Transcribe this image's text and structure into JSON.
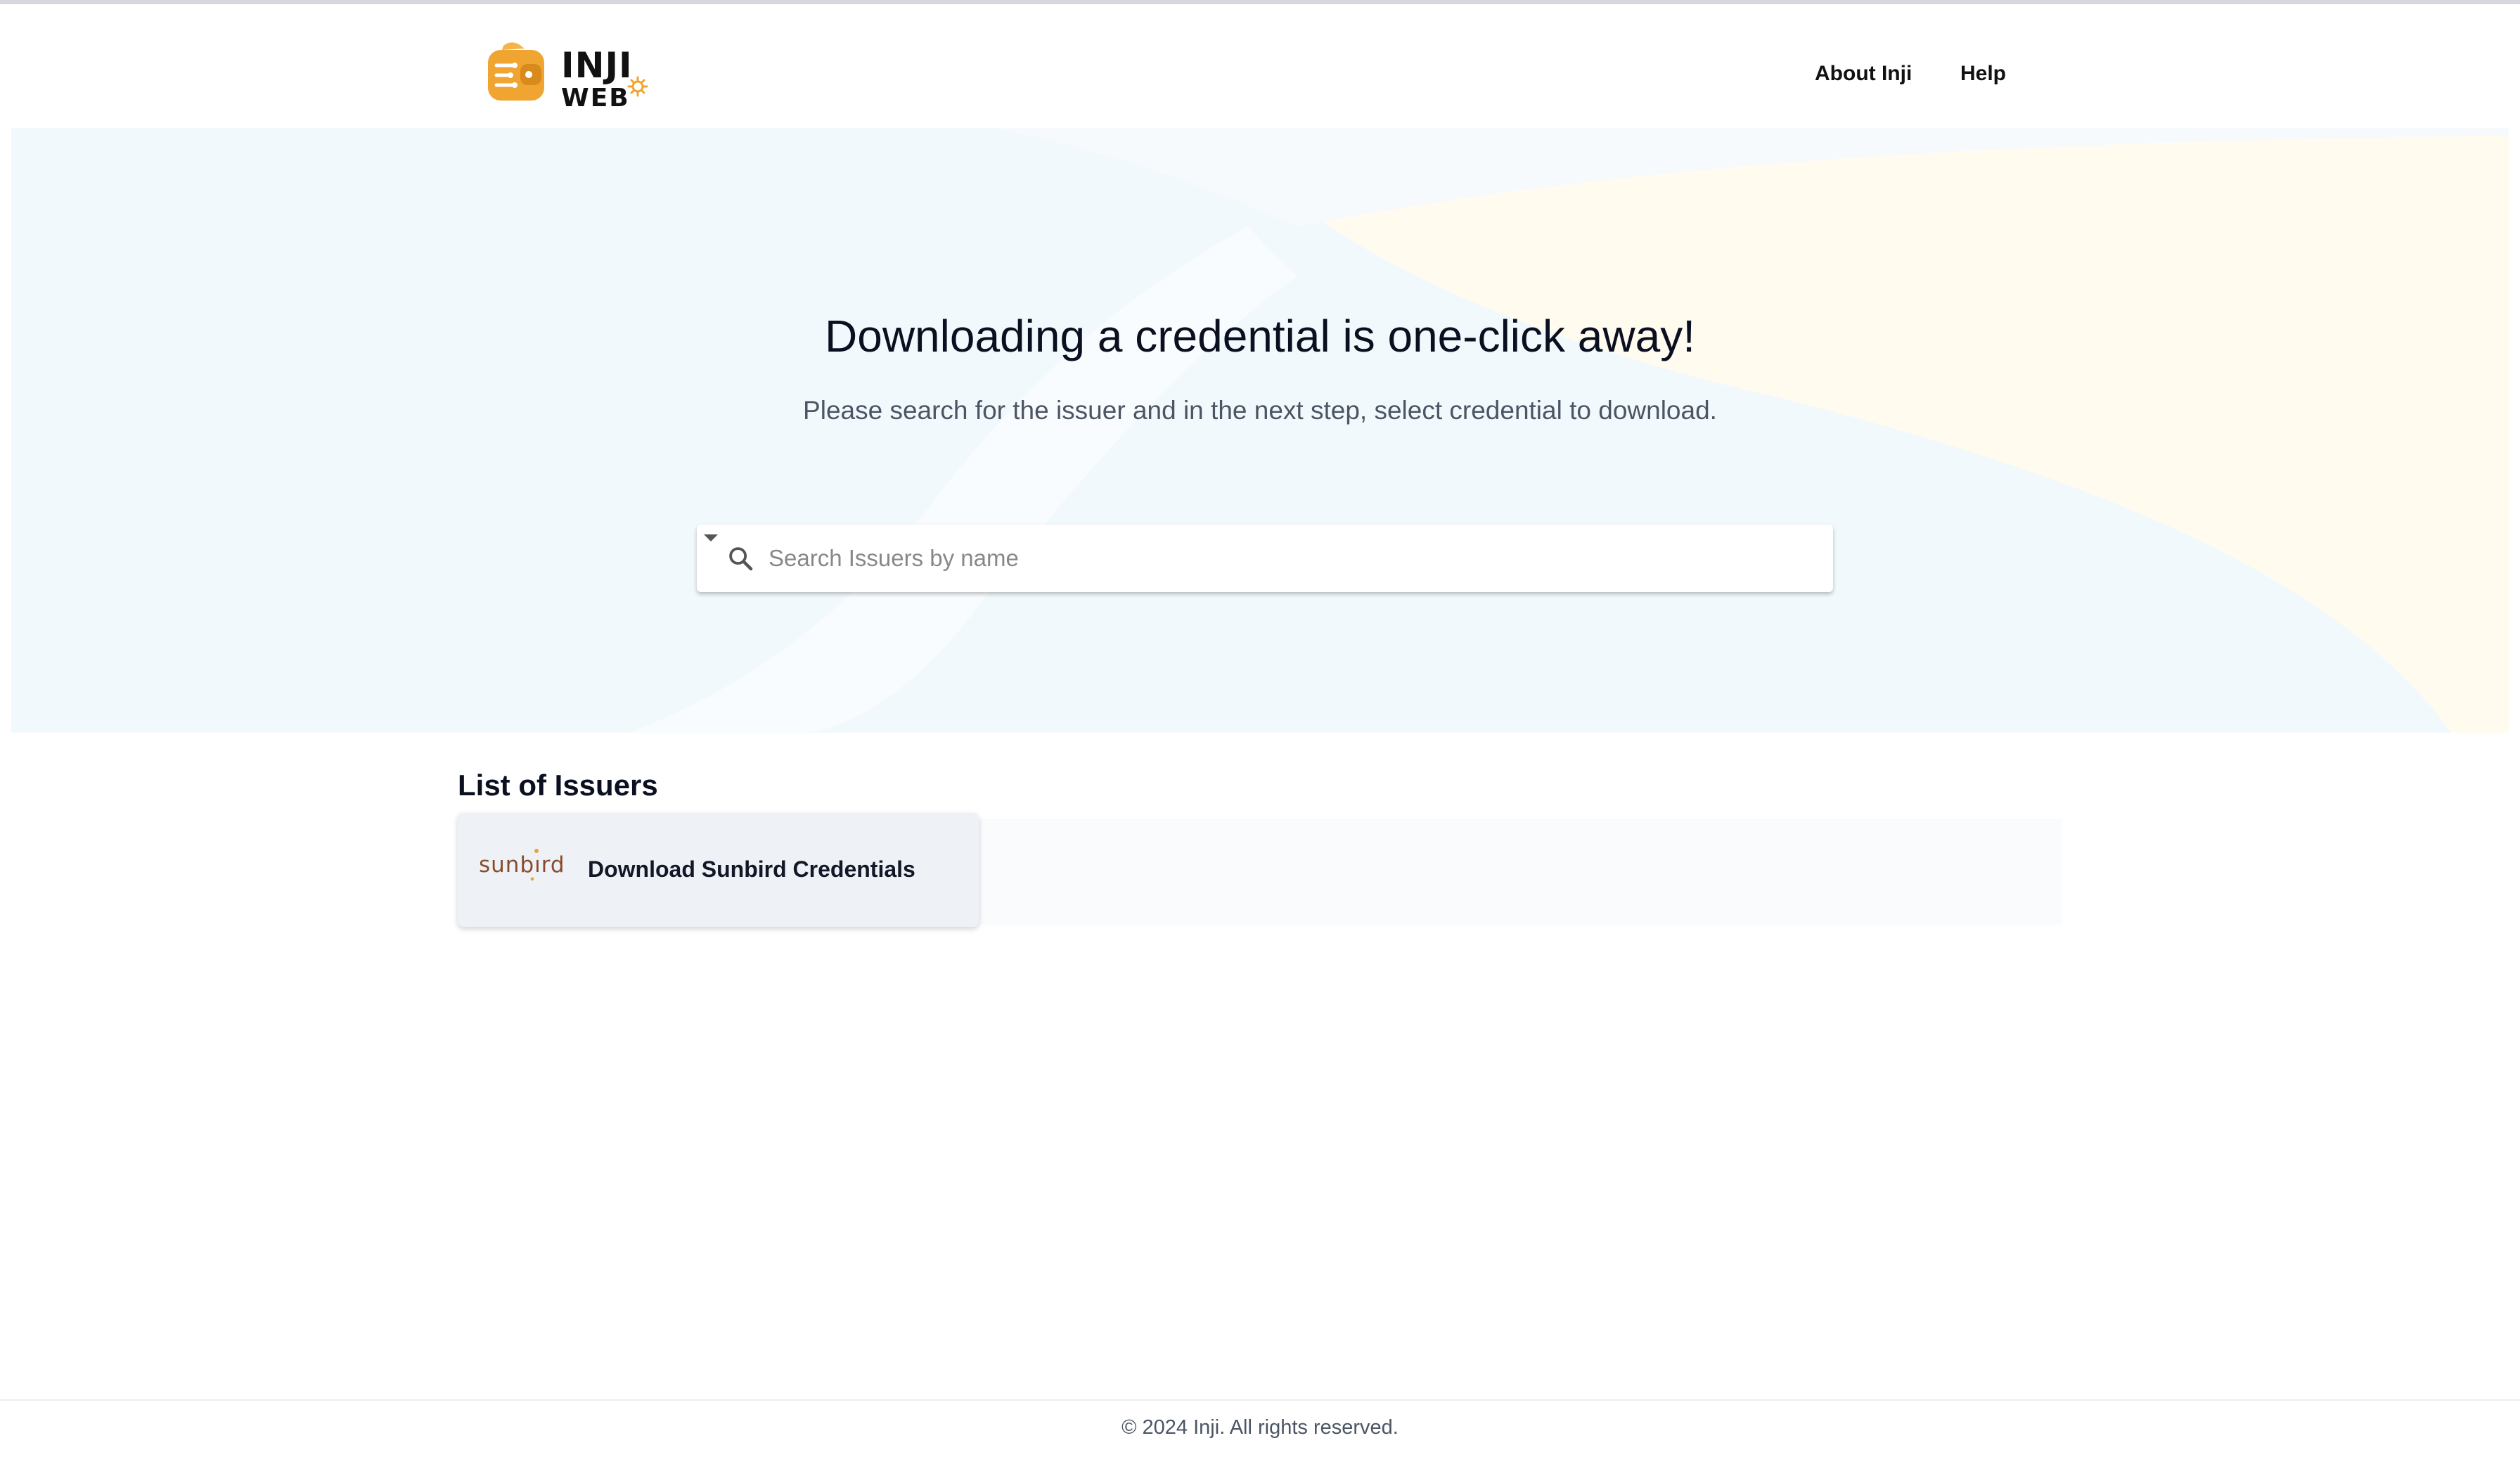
{
  "header": {
    "logo": {
      "line1": "INJI",
      "line2": "WEB"
    },
    "nav": [
      {
        "label": "About Inji"
      },
      {
        "label": "Help"
      }
    ]
  },
  "hero": {
    "title": "Downloading a credential is one-click away!",
    "subtitle": "Please search for the issuer and in the next step, select credential to download."
  },
  "search": {
    "placeholder": "Search Issuers by name",
    "value": "",
    "icon": "search-icon",
    "dropdown_icon": "caret-down-icon"
  },
  "issuers": {
    "section_title": "List of Issuers",
    "items": [
      {
        "logo_text": "sunbırd",
        "label": "Download Sunbird Credentials"
      }
    ]
  },
  "footer": {
    "text": "© 2024 Inji. All rights reserved."
  },
  "colors": {
    "hero_blue": "#f2f9fd",
    "hero_cream": "#fffbef",
    "brand_orange": "#f0a431",
    "sunbird_brown": "#8a4b2c"
  }
}
